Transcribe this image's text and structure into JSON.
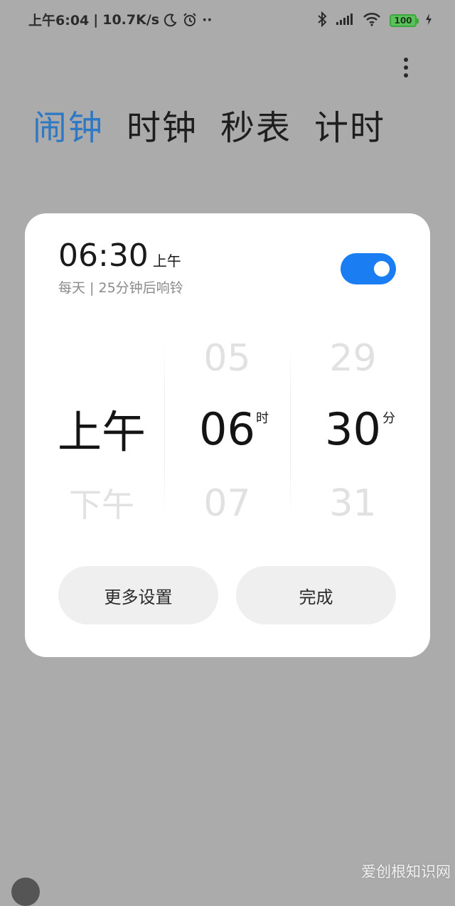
{
  "status_bar": {
    "time": "上午6:04",
    "speed": "10.7K/s",
    "more": "··",
    "battery": "100"
  },
  "tabs": [
    {
      "label": "闹钟",
      "active": true
    },
    {
      "label": "时钟",
      "active": false
    },
    {
      "label": "秒表",
      "active": false
    },
    {
      "label": "计时",
      "active": false
    }
  ],
  "dialog": {
    "time": "06:30",
    "period": "上午",
    "subtitle": "每天 | 25分钟后响铃",
    "enabled": true,
    "picker": {
      "period": {
        "selected": "上午",
        "next": "下午"
      },
      "hour": {
        "prev": "05",
        "selected": "06",
        "next": "07",
        "unit": "时"
      },
      "minute": {
        "prev": "29",
        "selected": "30",
        "next": "31",
        "unit": "分"
      }
    },
    "more_settings_label": "更多设置",
    "done_label": "完成"
  },
  "watermark": "爱创根知识网",
  "colors": {
    "accent": "#2f78c5",
    "toggle_on": "#1a7ef2",
    "battery": "#5cc05c"
  }
}
